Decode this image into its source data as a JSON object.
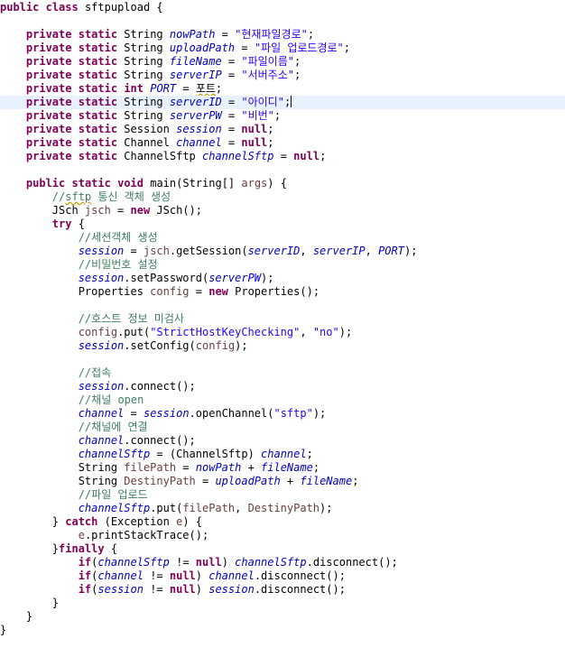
{
  "editor": {
    "current_line": 7,
    "lines": [
      [
        [
          "kw",
          "public"
        ],
        [
          "p",
          " "
        ],
        [
          "kw",
          "class"
        ],
        [
          "p",
          " sftpupload {"
        ]
      ],
      [],
      [
        [
          "p",
          "    "
        ],
        [
          "kw",
          "private"
        ],
        [
          "p",
          " "
        ],
        [
          "kw",
          "static"
        ],
        [
          "p",
          " String "
        ],
        [
          "fld",
          "nowPath"
        ],
        [
          "p",
          " = "
        ],
        [
          "str",
          "\"현재파일경로\""
        ],
        [
          "p",
          ";"
        ]
      ],
      [
        [
          "p",
          "    "
        ],
        [
          "kw",
          "private"
        ],
        [
          "p",
          " "
        ],
        [
          "kw",
          "static"
        ],
        [
          "p",
          " String "
        ],
        [
          "fld",
          "uploadPath"
        ],
        [
          "p",
          " = "
        ],
        [
          "str",
          "\"파일 업로드경로\""
        ],
        [
          "p",
          ";"
        ]
      ],
      [
        [
          "p",
          "    "
        ],
        [
          "kw",
          "private"
        ],
        [
          "p",
          " "
        ],
        [
          "kw",
          "static"
        ],
        [
          "p",
          " String "
        ],
        [
          "fld",
          "fileName"
        ],
        [
          "p",
          " = "
        ],
        [
          "str",
          "\"파일이름\""
        ],
        [
          "p",
          ";"
        ]
      ],
      [
        [
          "p",
          "    "
        ],
        [
          "kw",
          "private"
        ],
        [
          "p",
          " "
        ],
        [
          "kw",
          "static"
        ],
        [
          "p",
          " String "
        ],
        [
          "fld",
          "serverIP"
        ],
        [
          "p",
          " = "
        ],
        [
          "str",
          "\"서버주소\""
        ],
        [
          "p",
          ";"
        ]
      ],
      [
        [
          "p",
          "    "
        ],
        [
          "kw",
          "private"
        ],
        [
          "p",
          " "
        ],
        [
          "kw",
          "static"
        ],
        [
          "p",
          " "
        ],
        [
          "kw",
          "int"
        ],
        [
          "p",
          " "
        ],
        [
          "fld",
          "PORT"
        ],
        [
          "p",
          " = "
        ],
        [
          "u",
          "포트"
        ],
        [
          "p",
          ";"
        ]
      ],
      [
        [
          "p",
          "    "
        ],
        [
          "kw",
          "private"
        ],
        [
          "p",
          " "
        ],
        [
          "kw",
          "static"
        ],
        [
          "p",
          " String "
        ],
        [
          "fld",
          "serverID"
        ],
        [
          "p",
          " = "
        ],
        [
          "str",
          "\"아이디\""
        ],
        [
          "p",
          ";"
        ],
        [
          "caret",
          ""
        ]
      ],
      [
        [
          "p",
          "    "
        ],
        [
          "kw",
          "private"
        ],
        [
          "p",
          " "
        ],
        [
          "kw",
          "static"
        ],
        [
          "p",
          " String "
        ],
        [
          "fld",
          "serverPW"
        ],
        [
          "p",
          " = "
        ],
        [
          "str",
          "\"비번\""
        ],
        [
          "p",
          ";"
        ]
      ],
      [
        [
          "p",
          "    "
        ],
        [
          "kw",
          "private"
        ],
        [
          "p",
          " "
        ],
        [
          "kw",
          "static"
        ],
        [
          "p",
          " Session "
        ],
        [
          "fld",
          "session"
        ],
        [
          "p",
          " = "
        ],
        [
          "kw",
          "null"
        ],
        [
          "p",
          ";"
        ]
      ],
      [
        [
          "p",
          "    "
        ],
        [
          "kw",
          "private"
        ],
        [
          "p",
          " "
        ],
        [
          "kw",
          "static"
        ],
        [
          "p",
          " Channel "
        ],
        [
          "fld",
          "channel"
        ],
        [
          "p",
          " = "
        ],
        [
          "kw",
          "null"
        ],
        [
          "p",
          ";"
        ]
      ],
      [
        [
          "p",
          "    "
        ],
        [
          "kw",
          "private"
        ],
        [
          "p",
          " "
        ],
        [
          "kw",
          "static"
        ],
        [
          "p",
          " ChannelSftp "
        ],
        [
          "fld",
          "channelSftp"
        ],
        [
          "p",
          " = "
        ],
        [
          "kw",
          "null"
        ],
        [
          "p",
          ";"
        ]
      ],
      [],
      [
        [
          "p",
          "    "
        ],
        [
          "kw",
          "public"
        ],
        [
          "p",
          " "
        ],
        [
          "kw",
          "static"
        ],
        [
          "p",
          " "
        ],
        [
          "kw",
          "void"
        ],
        [
          "p",
          " main(String[] "
        ],
        [
          "var",
          "args"
        ],
        [
          "p",
          ") {"
        ]
      ],
      [
        [
          "p",
          "        "
        ],
        [
          "cmt",
          "//"
        ],
        [
          "ucmt",
          "sftp"
        ],
        [
          "cmt",
          " 통신 객체 생성"
        ]
      ],
      [
        [
          "p",
          "        JSch "
        ],
        [
          "var",
          "jsch"
        ],
        [
          "p",
          " = "
        ],
        [
          "kw",
          "new"
        ],
        [
          "p",
          " JSch();"
        ]
      ],
      [
        [
          "p",
          "        "
        ],
        [
          "kw",
          "try"
        ],
        [
          "p",
          " {"
        ]
      ],
      [
        [
          "p",
          "            "
        ],
        [
          "cmt",
          "//세션객체 생성"
        ]
      ],
      [
        [
          "p",
          "            "
        ],
        [
          "fld",
          "session"
        ],
        [
          "p",
          " = "
        ],
        [
          "var",
          "jsch"
        ],
        [
          "p",
          ".getSession("
        ],
        [
          "fld",
          "serverID"
        ],
        [
          "p",
          ", "
        ],
        [
          "fld",
          "serverIP"
        ],
        [
          "p",
          ", "
        ],
        [
          "fld",
          "PORT"
        ],
        [
          "p",
          ");"
        ]
      ],
      [
        [
          "p",
          "            "
        ],
        [
          "cmt",
          "//비밀번호 설정"
        ]
      ],
      [
        [
          "p",
          "            "
        ],
        [
          "fld",
          "session"
        ],
        [
          "p",
          ".setPassword("
        ],
        [
          "fld",
          "serverPW"
        ],
        [
          "p",
          ");"
        ]
      ],
      [
        [
          "p",
          "            Properties "
        ],
        [
          "var",
          "config"
        ],
        [
          "p",
          " = "
        ],
        [
          "kw",
          "new"
        ],
        [
          "p",
          " Properties();"
        ]
      ],
      [],
      [
        [
          "p",
          "            "
        ],
        [
          "cmt",
          "//호스트 정보 미검사"
        ]
      ],
      [
        [
          "p",
          "            "
        ],
        [
          "var",
          "config"
        ],
        [
          "p",
          ".put("
        ],
        [
          "str",
          "\"StrictHostKeyChecking\""
        ],
        [
          "p",
          ", "
        ],
        [
          "str",
          "\"no\""
        ],
        [
          "p",
          ");"
        ]
      ],
      [
        [
          "p",
          "            "
        ],
        [
          "fld",
          "session"
        ],
        [
          "p",
          ".setConfig("
        ],
        [
          "var",
          "config"
        ],
        [
          "p",
          ");"
        ]
      ],
      [],
      [
        [
          "p",
          "            "
        ],
        [
          "cmt",
          "//접속"
        ]
      ],
      [
        [
          "p",
          "            "
        ],
        [
          "fld",
          "session"
        ],
        [
          "p",
          ".connect();"
        ]
      ],
      [
        [
          "p",
          "            "
        ],
        [
          "cmt",
          "//채널 open"
        ]
      ],
      [
        [
          "p",
          "            "
        ],
        [
          "fld",
          "channel"
        ],
        [
          "p",
          " = "
        ],
        [
          "fld",
          "session"
        ],
        [
          "p",
          ".openChannel("
        ],
        [
          "str",
          "\"sftp\""
        ],
        [
          "p",
          ");"
        ]
      ],
      [
        [
          "p",
          "            "
        ],
        [
          "cmt",
          "//채널에 연결"
        ]
      ],
      [
        [
          "p",
          "            "
        ],
        [
          "fld",
          "channel"
        ],
        [
          "p",
          ".connect();"
        ]
      ],
      [
        [
          "p",
          "            "
        ],
        [
          "fld",
          "channelSftp"
        ],
        [
          "p",
          " = (ChannelSftp) "
        ],
        [
          "fld",
          "channel"
        ],
        [
          "p",
          ";"
        ]
      ],
      [
        [
          "p",
          "            String "
        ],
        [
          "var",
          "filePath"
        ],
        [
          "p",
          " = "
        ],
        [
          "fld",
          "nowPath"
        ],
        [
          "p",
          " + "
        ],
        [
          "fld",
          "fileName"
        ],
        [
          "p",
          ";"
        ]
      ],
      [
        [
          "p",
          "            String "
        ],
        [
          "var",
          "DestinyPath"
        ],
        [
          "p",
          " = "
        ],
        [
          "fld",
          "uploadPath"
        ],
        [
          "p",
          " + "
        ],
        [
          "fld",
          "fileName"
        ],
        [
          "p",
          ";"
        ]
      ],
      [
        [
          "p",
          "            "
        ],
        [
          "cmt",
          "//파일 업로드"
        ]
      ],
      [
        [
          "p",
          "            "
        ],
        [
          "fld",
          "channelSftp"
        ],
        [
          "p",
          ".put("
        ],
        [
          "var",
          "filePath"
        ],
        [
          "p",
          ", "
        ],
        [
          "var",
          "DestinyPath"
        ],
        [
          "p",
          ");"
        ]
      ],
      [
        [
          "p",
          "        } "
        ],
        [
          "kw",
          "catch"
        ],
        [
          "p",
          " (Exception "
        ],
        [
          "var",
          "e"
        ],
        [
          "p",
          ") {"
        ]
      ],
      [
        [
          "p",
          "            "
        ],
        [
          "var",
          "e"
        ],
        [
          "p",
          ".printStackTrace();"
        ]
      ],
      [
        [
          "p",
          "        }"
        ],
        [
          "kw",
          "finally"
        ],
        [
          "p",
          " {"
        ]
      ],
      [
        [
          "p",
          "            "
        ],
        [
          "kw",
          "if"
        ],
        [
          "p",
          "("
        ],
        [
          "fld",
          "channelSftp"
        ],
        [
          "p",
          " != "
        ],
        [
          "kw",
          "null"
        ],
        [
          "p",
          ") "
        ],
        [
          "fld",
          "channelSftp"
        ],
        [
          "p",
          ".disconnect();"
        ]
      ],
      [
        [
          "p",
          "            "
        ],
        [
          "kw",
          "if"
        ],
        [
          "p",
          "("
        ],
        [
          "fld",
          "channel"
        ],
        [
          "p",
          " != "
        ],
        [
          "kw",
          "null"
        ],
        [
          "p",
          ") "
        ],
        [
          "fld",
          "channel"
        ],
        [
          "p",
          ".disconnect();"
        ]
      ],
      [
        [
          "p",
          "            "
        ],
        [
          "kw",
          "if"
        ],
        [
          "p",
          "("
        ],
        [
          "fld",
          "session"
        ],
        [
          "p",
          " != "
        ],
        [
          "kw",
          "null"
        ],
        [
          "p",
          ") "
        ],
        [
          "fld",
          "session"
        ],
        [
          "p",
          ".disconnect();"
        ]
      ],
      [
        [
          "p",
          "        }"
        ]
      ],
      [
        [
          "p",
          "    }"
        ]
      ],
      [
        [
          "p",
          "}"
        ]
      ]
    ]
  }
}
